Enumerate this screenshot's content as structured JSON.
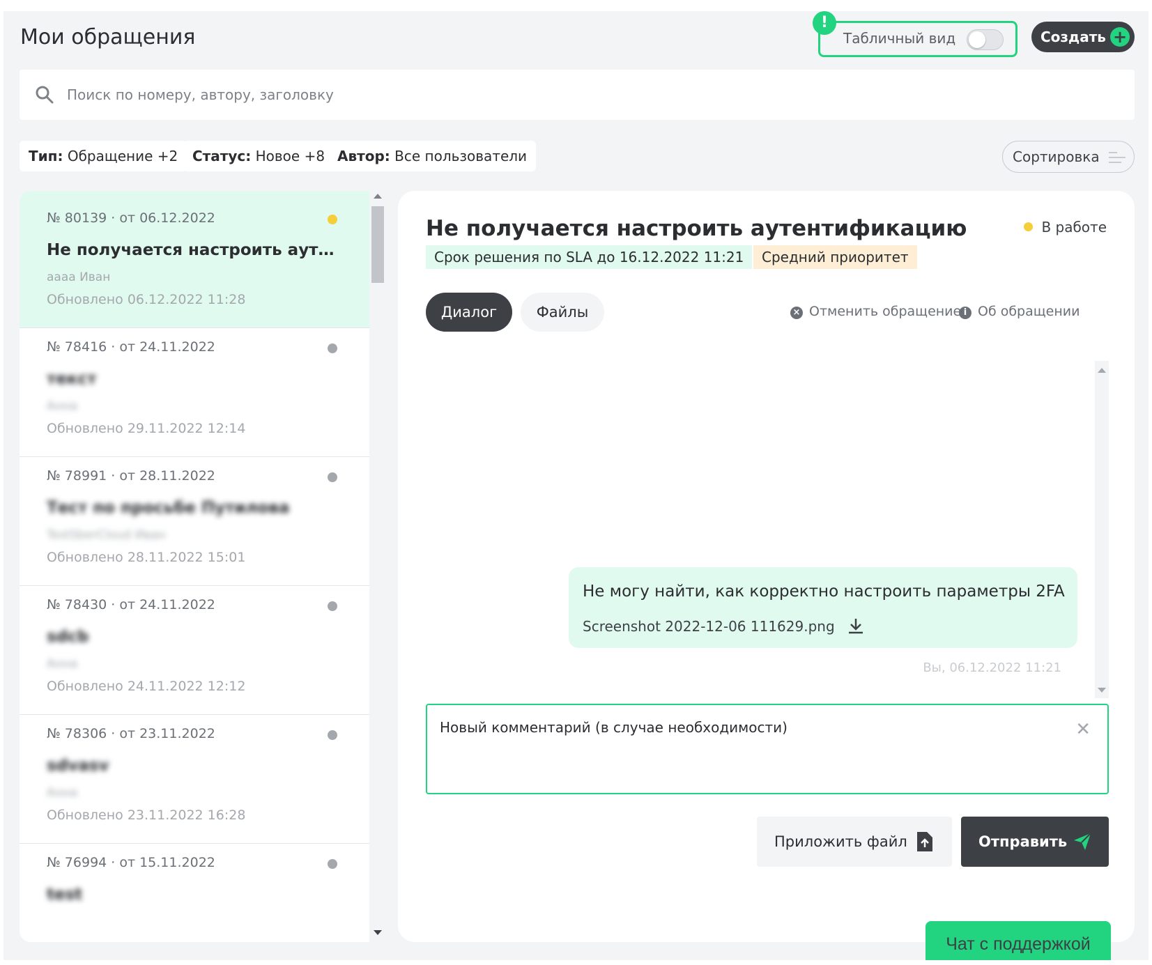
{
  "header": {
    "title": "Мои обращения",
    "table_view_label": "Табличный вид",
    "table_view_enabled": false,
    "alert_badge": "!",
    "create_label": "Создать"
  },
  "search": {
    "placeholder": "Поиск по номеру, автору, заголовку",
    "value": ""
  },
  "filters": [
    {
      "key": "Тип:",
      "value": "Обращение +2"
    },
    {
      "key": "Статус:",
      "value": "Новое +8"
    },
    {
      "key": "Автор:",
      "value": "Все пользователи"
    }
  ],
  "sort_label": "Сортировка",
  "tickets": [
    {
      "meta": "№ 80139 · от 06.12.2022",
      "title": "Не получается настроить аутентификацию",
      "author": "аааа Иван",
      "updated": "Обновлено 06.12.2022 11:28",
      "status": "yellow",
      "active": true
    },
    {
      "meta": "№ 78416 · от 24.11.2022",
      "title": "текст",
      "author": "Анна",
      "updated": "Обновлено 29.11.2022 12:14",
      "status": "grey"
    },
    {
      "meta": "№ 78991 · от 28.11.2022",
      "title": "Тест по просьбе Путилова",
      "author": "TestSberCloud Иван",
      "updated": "Обновлено 28.11.2022 15:01",
      "status": "grey"
    },
    {
      "meta": "№ 78430 · от 24.11.2022",
      "title": "sdcb",
      "author": "Анна",
      "updated": "Обновлено 24.11.2022 12:12",
      "status": "grey"
    },
    {
      "meta": "№ 78306 · от 23.11.2022",
      "title": "sdvasv",
      "author": "Анна",
      "updated": "Обновлено 23.11.2022 16:28",
      "status": "grey"
    },
    {
      "meta": "№ 76994 · от 15.11.2022",
      "title": "test",
      "author": "",
      "updated": "",
      "status": "grey"
    }
  ],
  "detail": {
    "title": "Не получается настроить аутентификацию",
    "status": "В работе",
    "sla": "Срок решения по SLA до 16.12.2022 11:21",
    "priority": "Средний приоритет",
    "tabs": [
      "Диалог",
      "Файлы"
    ],
    "cancel_label": "Отменить обращение",
    "about_label": "Об обращении",
    "message": {
      "text": "Не могу найти, как корректно настроить параметры 2FA",
      "file": "Screenshot 2022-12-06 111629.png",
      "time": "Вы, 06.12.2022 11:21"
    },
    "comment_placeholder": "Новый комментарий (в случае необходимости)",
    "attach_label": "Приложить файл",
    "send_label": "Отправить"
  },
  "support_chat_label": "Чат с поддержкой",
  "colors": {
    "accent": "#22d37f",
    "dark": "#3d4146",
    "active_bg": "#e1faef",
    "priority_bg": "#fdeed5",
    "status_yellow": "#f5cf3b"
  }
}
